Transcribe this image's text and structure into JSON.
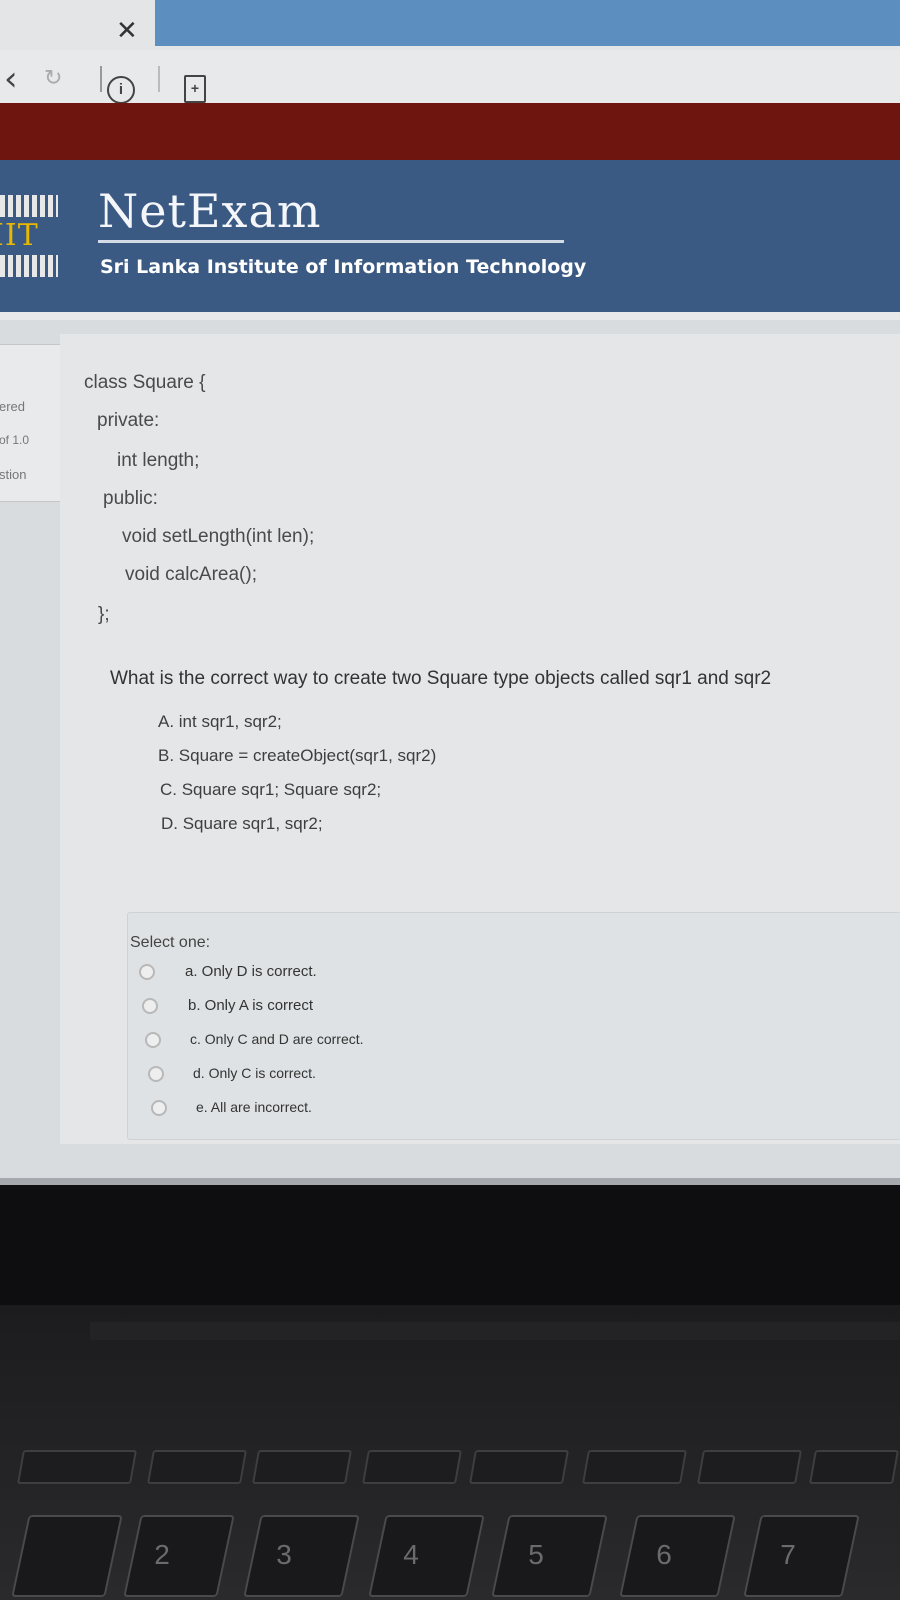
{
  "browser": {
    "tab_close": "✕",
    "back_glyph": "‹",
    "reload_glyph": "↻",
    "info_glyph": "i",
    "page_glyph": "+"
  },
  "header": {
    "logo_text": "IIT",
    "brand": "NetExam",
    "institute": "Sri Lanka Institute of Information Technology"
  },
  "info_panel": {
    "answered": "ered",
    "marks": "of 1.0",
    "question": "stion"
  },
  "code_lines": [
    "class Square {",
    "private:",
    "int length;",
    "public:",
    "void setLength(int len);",
    "void calcArea();",
    "};"
  ],
  "question": {
    "text": "What is the correct way to create two Square type objects called sqr1 and sqr2",
    "options": [
      "A. int sqr1, sqr2;",
      "B. Square = createObject(sqr1, sqr2)",
      "C. Square sqr1; Square sqr2;",
      "D. Square sqr1, sqr2;"
    ]
  },
  "answers": {
    "label": "Select one:",
    "choices": [
      "a. Only D is correct.",
      "b. Only A is correct",
      "c. Only C and D are correct.",
      "d. Only C is correct.",
      "e. All are incorrect."
    ]
  },
  "keyboard": {
    "keys": [
      "2",
      "3",
      "4",
      "5",
      "6",
      "7"
    ]
  }
}
